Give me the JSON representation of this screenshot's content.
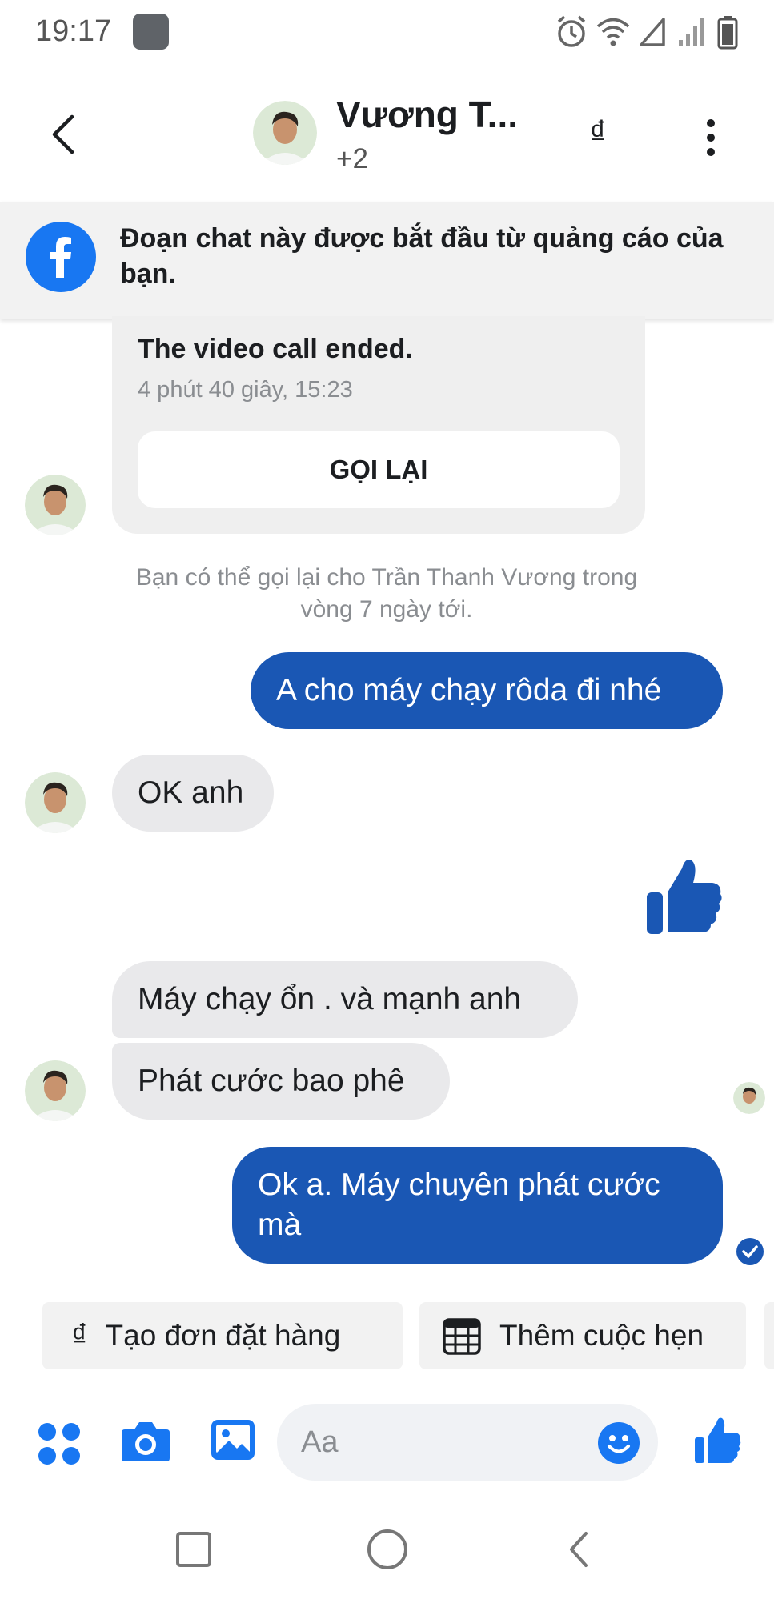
{
  "status_bar": {
    "time": "19:17"
  },
  "header": {
    "contact_name": "Vương T...",
    "contact_sub": "+2",
    "currency_symbol": "₫"
  },
  "ad_banner": {
    "text": "Đoạn chat này được bắt đầu từ quảng cáo của bạn."
  },
  "call_card": {
    "title": "The video call ended.",
    "meta": "4 phút 40 giây, 15:23",
    "call_back_label": "GỌI LẠI"
  },
  "call_hint": "Bạn có thể gọi lại cho Trần Thanh Vương trong vòng 7 ngày tới.",
  "messages": [
    {
      "side": "out",
      "text": "A cho máy chạy rôda đi nhé"
    },
    {
      "side": "in",
      "text": "OK anh"
    },
    {
      "side": "out",
      "sticker": "thumbs-up"
    },
    {
      "side": "in",
      "text": "Máy chạy ổn . và mạnh anh"
    },
    {
      "side": "in",
      "text": "Phát cước bao phê"
    },
    {
      "side": "out",
      "text": "Ok a. Máy chuyên phát cước mà"
    }
  ],
  "quick_actions": [
    {
      "label": "Tạo đơn đặt hàng",
      "icon": "₫"
    },
    {
      "label": "Thêm cuộc hẹn",
      "icon": "calendar-icon"
    }
  ],
  "composer": {
    "placeholder": "Aa"
  },
  "colors": {
    "outgoing_bubble": "#1a57b4",
    "incoming_bubble": "#e9e9eb",
    "accent": "#1877f2"
  }
}
